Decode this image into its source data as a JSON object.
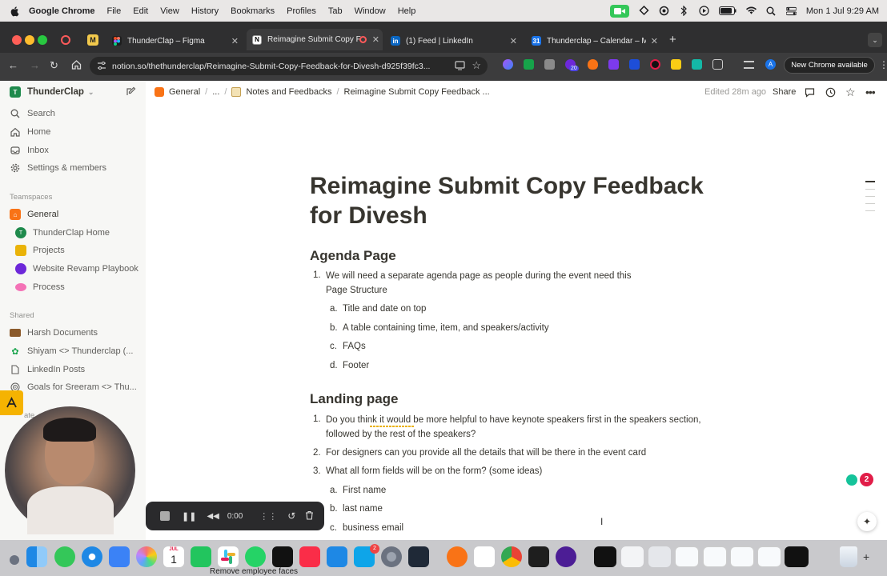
{
  "menubar": {
    "app": "Google Chrome",
    "items": [
      "File",
      "Edit",
      "View",
      "History",
      "Bookmarks",
      "Profiles",
      "Tab",
      "Window",
      "Help"
    ],
    "datetime": "Mon 1 Jul  9:29 AM"
  },
  "tabs": [
    {
      "title": "ThunderClap – Figma",
      "icon": "figma-icon",
      "color": "#1e1e1e"
    },
    {
      "title": "Reimagine Submit Copy F",
      "icon": "notion-icon",
      "color": "#ffffff",
      "active": true
    },
    {
      "title": "(1) Feed | LinkedIn",
      "icon": "linkedin-icon",
      "color": "#0a66c2"
    },
    {
      "title": "Thunderclap – Calendar – Mo",
      "icon": "calendar-icon",
      "color": "#1a73e8"
    }
  ],
  "address": {
    "url": "notion.so/thethunderclap/Reimagine-Submit-Copy-Feedback-for-Divesh-d925f39fc3...",
    "badge_count": "20",
    "update_label": "New Chrome available"
  },
  "sidebar": {
    "workspace": "ThunderClap",
    "nav": [
      {
        "label": "Search",
        "icon": "search-icon"
      },
      {
        "label": "Home",
        "icon": "home-icon"
      },
      {
        "label": "Inbox",
        "icon": "inbox-icon"
      },
      {
        "label": "Settings & members",
        "icon": "gear-icon"
      }
    ],
    "teamspaces_label": "Teamspaces",
    "teamspace": "General",
    "pages": [
      {
        "label": "ThunderClap Home",
        "icon": "thunderclap-icon"
      },
      {
        "label": "Projects",
        "icon": "projects-icon"
      },
      {
        "label": "Website Revamp Playbook",
        "icon": "playbook-icon"
      },
      {
        "label": "Process",
        "icon": "brain-icon"
      }
    ],
    "shared_label": "Shared",
    "shared": [
      {
        "label": "Harsh Documents",
        "icon": "folder-icon"
      },
      {
        "label": "Shiyam <> Thunderclap (...",
        "icon": "plant-icon"
      },
      {
        "label": "LinkedIn Posts",
        "icon": "document-icon"
      },
      {
        "label": "Goals for Sreeram <> Thu...",
        "icon": "target-icon"
      }
    ],
    "private_label": "ate"
  },
  "breadcrumb": {
    "items": [
      "General",
      "...",
      "Notes and Feedbacks",
      "Reimagine Submit Copy Feedback ..."
    ],
    "edited": "Edited 28m ago",
    "share": "Share"
  },
  "page": {
    "title": "Reimagine Submit Copy Feedback for Divesh",
    "sections": [
      {
        "heading": "Agenda Page",
        "items": [
          {
            "num": "1.",
            "text": "We will need a separate agenda page as people during the event need this",
            "text2": "Page Structure"
          },
          {
            "num": "a.",
            "text": "Title and date on top"
          },
          {
            "num": "b.",
            "text": "A table containing time, item, and speakers/activity"
          },
          {
            "num": "c.",
            "text": "FAQs"
          },
          {
            "num": "d.",
            "text": "Footer"
          }
        ]
      },
      {
        "heading": "Landing page",
        "items": [
          {
            "num": "1.",
            "text": "Do you think it would be more helpful to have keynote speakers first in the speakers section,",
            "text2": "followed by the rest of the speakers?"
          },
          {
            "num": "2.",
            "text": "For designers can you provide all the details that will be there in the event card"
          },
          {
            "num": "3.",
            "text": "What all form fields will be on the form? (some ideas)"
          },
          {
            "num": "a.",
            "text": "First name"
          },
          {
            "num": "b.",
            "text": "last name"
          },
          {
            "num": "c.",
            "text": "business email"
          }
        ]
      }
    ]
  },
  "recorder": {
    "time": "0:00"
  },
  "dock_peek_text": "Remove employee faces",
  "calendar_day": "1",
  "calendar_month": "JUL"
}
